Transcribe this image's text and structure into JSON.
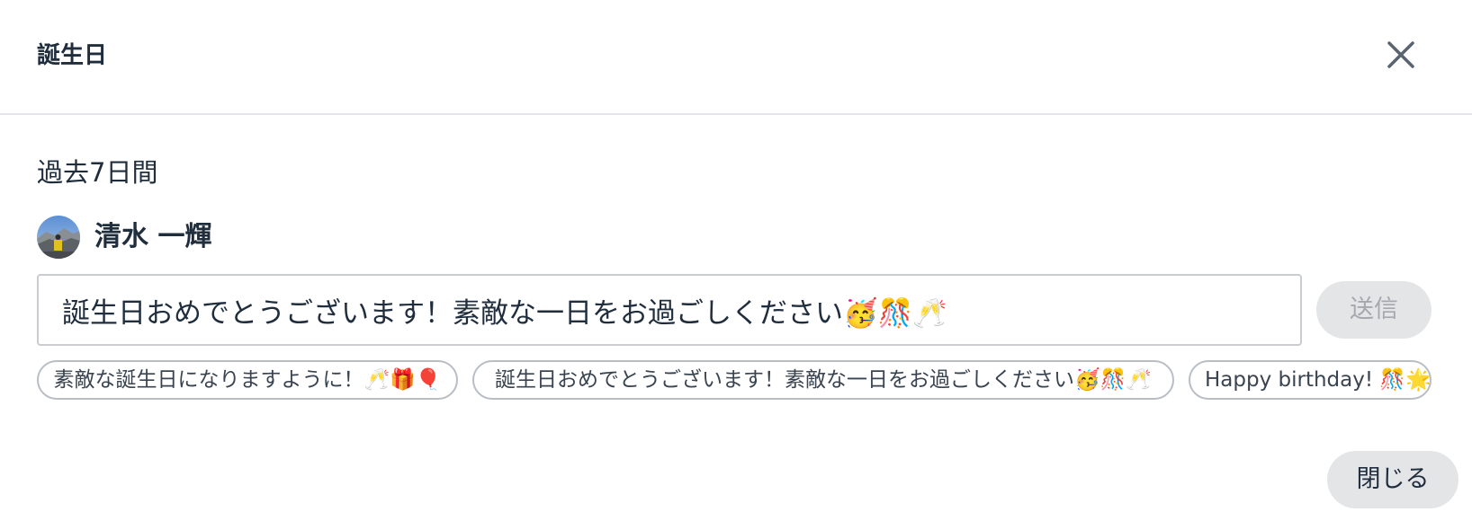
{
  "dialog": {
    "title": "誕生日",
    "close_icon": "close-icon"
  },
  "section": {
    "label": "過去7日間"
  },
  "person": {
    "name": "清水 一輝",
    "avatar_icon": "avatar-photo"
  },
  "message": {
    "value": "誕生日おめでとうございます！素敵な一日をお過ごしください🥳🎊🥂"
  },
  "send_button": {
    "label": "送信"
  },
  "suggestions": [
    {
      "label": "素敵な誕生日になりますように！🥂🎁🎈"
    },
    {
      "label": "誕生日おめでとうございます！素敵な一日をお過ごしください🥳🎊🥂"
    },
    {
      "label": "Happy birthday! 🎊🌟"
    }
  ],
  "footer": {
    "close_label": "閉じる"
  },
  "colors": {
    "text": "#1f2d3d",
    "button_bg": "#e4e5e7",
    "disabled_text": "#a5a9ae",
    "border": "#c9cdd2",
    "divider": "#e3e5e8"
  }
}
